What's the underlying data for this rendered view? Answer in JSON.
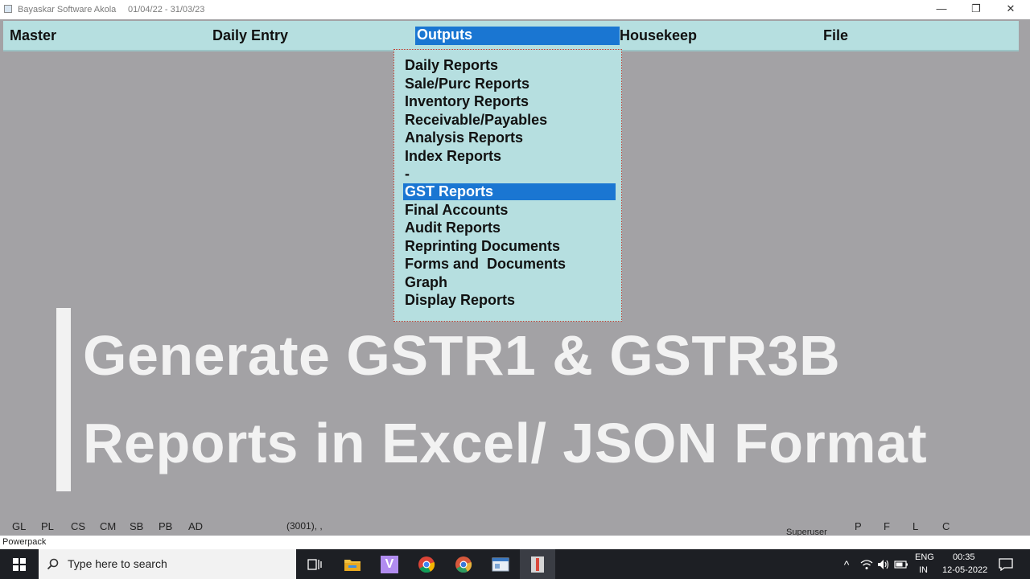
{
  "window": {
    "title": "Bayaskar Software Akola",
    "date_range": "01/04/22 - 31/03/23",
    "minimize": "—",
    "restore": "❐",
    "close": "✕"
  },
  "menubar": {
    "items": [
      "Master",
      "Daily Entry",
      "Outputs",
      "Housekeep",
      "File"
    ]
  },
  "dropdown": {
    "items": [
      "Daily Reports",
      "Sale/Purc Reports",
      "Inventory Reports",
      "Receivable/Payables",
      "Analysis Reports",
      "Index Reports",
      "-",
      "GST Reports",
      "Final Accounts",
      "Audit Reports",
      "Reprinting Documents",
      "Forms and  Documents",
      "Graph",
      "Display Reports"
    ],
    "selected_label": "GST Reports"
  },
  "overlay": {
    "line1": "Generate GSTR1 & GSTR3B",
    "line2": "Reports in Excel/ JSON Format"
  },
  "status": {
    "shortcuts": [
      "GL",
      "PL",
      "CS",
      "CM",
      "SB",
      "PB",
      "AD"
    ],
    "code": "(3001), ,",
    "user": "Superuser",
    "flags": [
      "P",
      "F",
      "L",
      "C"
    ],
    "bottom_label": "Powerpack"
  },
  "taskbar": {
    "search_placeholder": "Type here to search",
    "language_top": "ENG",
    "language_bottom": "IN",
    "time": "00:35",
    "date": "12-05-2022",
    "icons": [
      "windows-start-icon",
      "search-icon",
      "task-view-icon",
      "file-explorer-icon",
      "visual-studio-icon",
      "chrome-icon",
      "chrome-canary-icon",
      "app-window-icon",
      "active-app-icon"
    ]
  },
  "colors": {
    "accent": "#1a76d2",
    "menu_bg": "#b6dfe0",
    "desktop_bg": "#a3a2a5"
  }
}
